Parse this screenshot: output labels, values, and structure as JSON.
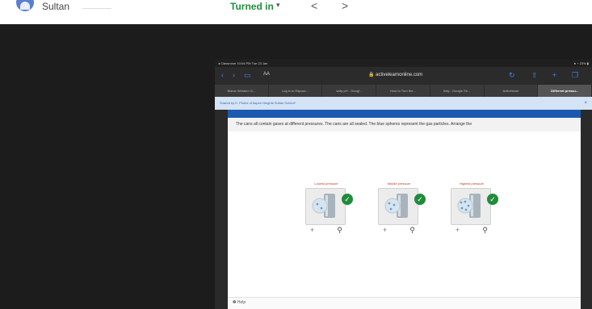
{
  "classroom": {
    "student_name": "Sultan",
    "status_label": "Turned in",
    "dropdown_icon": "▾",
    "prev_icon": "<",
    "next_icon": ">"
  },
  "ipad": {
    "status_left": "◂ Classroom  10:04 PM  Tue 23 Jan",
    "status_right": "● ◔ 23% ▮",
    "url_aa": "AA",
    "url": "🔒 activelearnonline.com",
    "tabs": [
      {
        "label": "Blame Western G..."
      },
      {
        "label": "Log in to Edpuzz..."
      },
      {
        "label": "sally pH - Googl..."
      },
      {
        "label": "How to Turn the..."
      },
      {
        "label": "Italy - Google Se..."
      },
      {
        "label": "Activelearn"
      },
      {
        "label": "Different pressu..."
      }
    ],
    "shared_text": "Shared by K. Pluntz of Aspen Heights Sultan School*",
    "close_icon": "×"
  },
  "activity": {
    "prompt": "The cans all contain gases at different pressures. The cans are all sealed. The blue spheres represent the gas particles. Arrange the",
    "cards": [
      {
        "label": "Lowest pressure"
      },
      {
        "label": "Middle pressure"
      },
      {
        "label": "Highest pressure"
      }
    ],
    "check_icon": "✓",
    "plus_icon": "+",
    "zoom_icon": "⚲",
    "help_label": "❷ Help"
  }
}
